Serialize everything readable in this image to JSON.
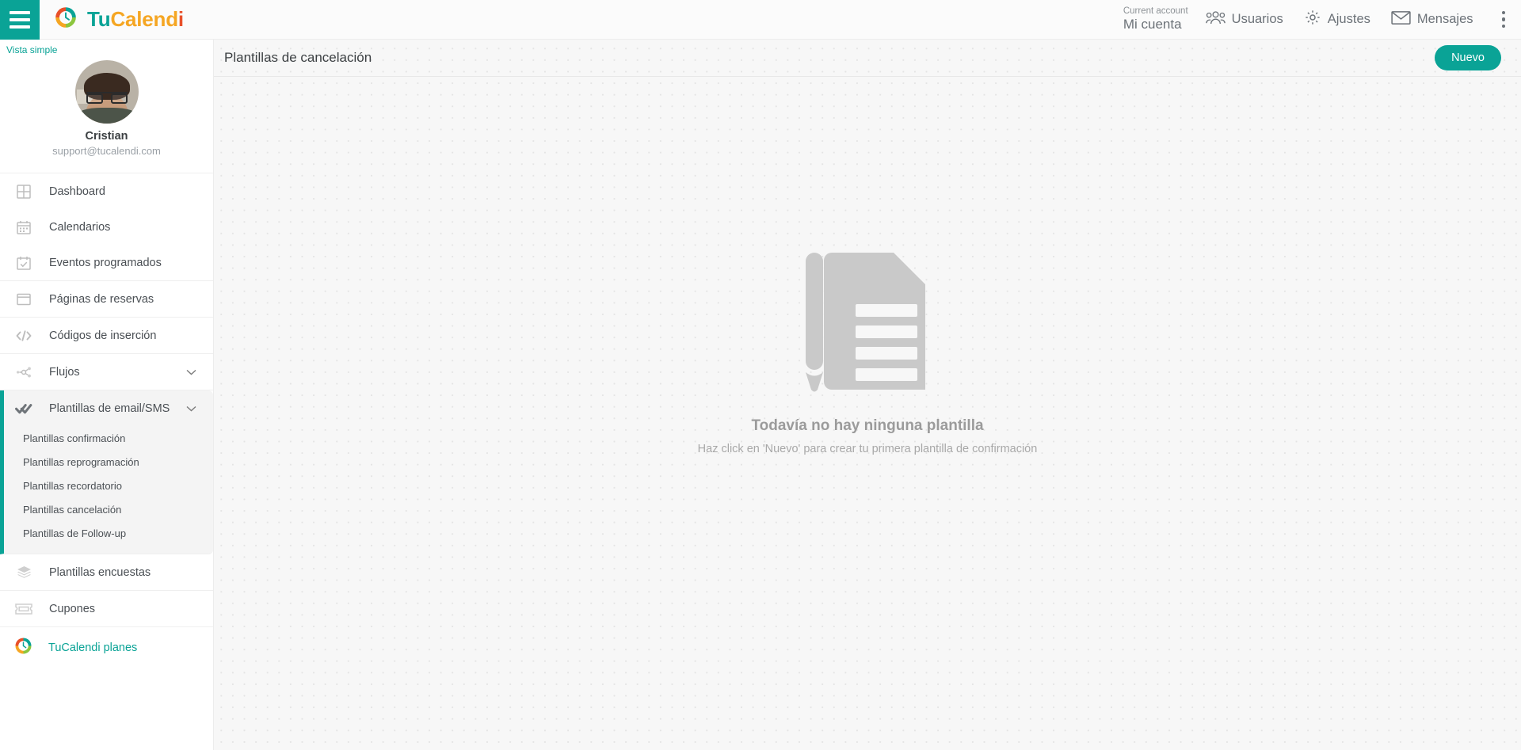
{
  "topbar": {
    "menu_icon": "hamburger-icon",
    "brand": {
      "part1": "Tu",
      "part2": "Calend",
      "part3": "i"
    },
    "account": {
      "label": "Current account",
      "value": "Mi cuenta"
    },
    "items": [
      {
        "label": "Usuarios",
        "icon": "users-icon"
      },
      {
        "label": "Ajustes",
        "icon": "gear-icon"
      },
      {
        "label": "Mensajes",
        "icon": "envelope-icon"
      }
    ],
    "overflow_icon": "kebab-menu-icon"
  },
  "sidebar": {
    "simple_view": "Vista simple",
    "profile": {
      "name": "Cristian",
      "email": "support@tucalendi.com"
    },
    "items": [
      {
        "label": "Dashboard",
        "icon": "grid-icon"
      },
      {
        "label": "Calendarios",
        "icon": "calendar-icon"
      },
      {
        "label": "Eventos programados",
        "icon": "calendar-check-icon"
      },
      {
        "label": "Páginas de reservas",
        "icon": "browser-window-icon"
      },
      {
        "label": "Códigos de inserción",
        "icon": "code-brackets-icon"
      },
      {
        "label": "Flujos",
        "icon": "flow-nodes-icon"
      }
    ],
    "active_section": {
      "label": "Plantillas de email/SMS",
      "icon": "double-check-icon",
      "subitems": [
        "Plantillas confirmación",
        "Plantillas reprogramación",
        "Plantillas recordatorio",
        "Plantillas cancelación",
        "Plantillas de Follow-up"
      ]
    },
    "tail_items": [
      {
        "label": "Plantillas encuestas",
        "icon": "layers-icon"
      },
      {
        "label": "Cupones",
        "icon": "ticket-icon"
      }
    ],
    "plans": {
      "label": "TuCalendi planes",
      "icon": "tucalendi-logo-icon"
    }
  },
  "main": {
    "title": "Plantillas de cancelación",
    "new_button": "Nuevo",
    "empty_state": {
      "illustration": "document-with-pencil-icon",
      "title": "Todavía no hay ninguna plantilla",
      "subtitle": "Haz click en 'Nuevo' para crear tu primera plantilla de confirmación"
    }
  },
  "colors": {
    "accent": "#0aa396",
    "brand_orange": "#f5a623",
    "brand_red": "#e8502a",
    "brand_green": "#8cc63e",
    "text": "#4a4f54",
    "muted": "#9aa0a6"
  }
}
